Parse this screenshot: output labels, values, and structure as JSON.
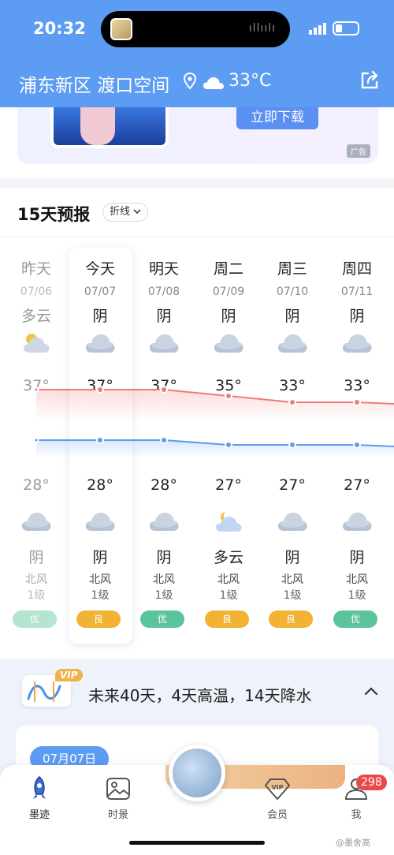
{
  "status_bar": {
    "time": "20:32",
    "sound_wave": "ıllıılı",
    "battery_level": 0.25
  },
  "header": {
    "location": "浦东新区 渡口空间",
    "temperature": "33°C",
    "icons": [
      "location-pin-icon",
      "cloud-icon",
      "share-icon"
    ]
  },
  "ad": {
    "button_label": "立即下载",
    "tag": "广告"
  },
  "forecast": {
    "title": "15天预报",
    "view_mode": "折线",
    "days": [
      {
        "day": "昨天",
        "date": "07/06",
        "day_condition": "多云",
        "high": "37°",
        "low": "28°",
        "night_condition": "阴",
        "wind": "北风",
        "wind_level": "1级",
        "air_quality": "优",
        "day_icon": "partly-cloudy-icon",
        "night_icon": "cloud-icon"
      },
      {
        "day": "今天",
        "date": "07/07",
        "day_condition": "阴",
        "high": "37°",
        "low": "28°",
        "night_condition": "阴",
        "wind": "北风",
        "wind_level": "1级",
        "air_quality": "良",
        "day_icon": "cloud-icon",
        "night_icon": "cloud-icon"
      },
      {
        "day": "明天",
        "date": "07/08",
        "day_condition": "阴",
        "high": "37°",
        "low": "28°",
        "night_condition": "阴",
        "wind": "北风",
        "wind_level": "1级",
        "air_quality": "优",
        "day_icon": "cloud-icon",
        "night_icon": "cloud-icon"
      },
      {
        "day": "周二",
        "date": "07/09",
        "day_condition": "阴",
        "high": "35°",
        "low": "27°",
        "night_condition": "多云",
        "wind": "北风",
        "wind_level": "1级",
        "air_quality": "良",
        "day_icon": "cloud-icon",
        "night_icon": "cloudy-night-icon"
      },
      {
        "day": "周三",
        "date": "07/10",
        "day_condition": "阴",
        "high": "33°",
        "low": "27°",
        "night_condition": "阴",
        "wind": "北风",
        "wind_level": "1级",
        "air_quality": "良",
        "day_icon": "cloud-icon",
        "night_icon": "cloud-icon"
      },
      {
        "day": "周四",
        "date": "07/11",
        "day_condition": "阴",
        "high": "33°",
        "low": "27°",
        "night_condition": "阴",
        "wind": "北风",
        "wind_level": "1级",
        "air_quality": "优",
        "day_icon": "cloud-icon",
        "night_icon": "cloud-icon"
      }
    ],
    "high_values": [
      37,
      37,
      37,
      35,
      33,
      33
    ],
    "low_values": [
      28,
      28,
      28,
      27,
      27,
      27
    ],
    "colors": {
      "good": "#5cc49a",
      "moderate": "#f2b233",
      "high_line": "#f07b7b",
      "low_line": "#5b9cf0"
    }
  },
  "forecast_40": {
    "vip_badge": "VIP",
    "summary": "未来40天，4天高温，14天降水",
    "date_pill": "07月07日"
  },
  "bottom_nav": {
    "items": [
      {
        "label": "墨迹",
        "icon": "rocket-icon"
      },
      {
        "label": "时景",
        "icon": "photo-icon"
      },
      {
        "label": "会员",
        "icon": "vip-diamond-icon"
      },
      {
        "label": "我",
        "icon": "profile-icon"
      }
    ],
    "notification_count": "298"
  },
  "watermark": "@墨舍高"
}
